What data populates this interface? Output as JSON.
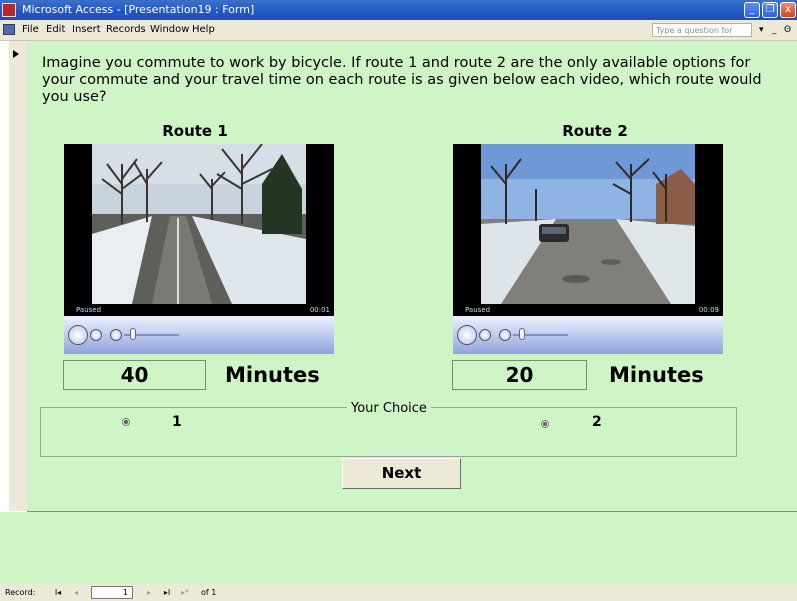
{
  "window": {
    "title": "Microsoft Access - [Presentation19 : Form]",
    "buttons": {
      "minimize": "_",
      "restore": "❐",
      "close": "x"
    }
  },
  "menu": {
    "items": [
      "File",
      "Edit",
      "Insert",
      "Records",
      "Window",
      "Help"
    ],
    "help_placeholder": "Type a question for help",
    "controls": [
      "▾",
      "_",
      "ʘ"
    ]
  },
  "form": {
    "question": "Imagine you commute to work by bicycle. If route 1 and route 2 are the only available options for your commute and your travel time on each route is as given below each video, which route would you use?",
    "routes": [
      {
        "title": "Route 1",
        "status": "Paused",
        "time": "00:01",
        "minutes": "40",
        "unit": "Minutes"
      },
      {
        "title": "Route 2",
        "status": "Paused",
        "time": "00:09",
        "minutes": "20",
        "unit": "Minutes"
      }
    ],
    "choice": {
      "label": "Your Choice",
      "options": [
        "1",
        "2"
      ]
    },
    "next_label": "Next"
  },
  "record_nav": {
    "label": "Record:",
    "first": "I◂",
    "prev": "◂",
    "current": "1",
    "next": "▸",
    "last": "▸I",
    "new": "▸*",
    "of_text": "of 1"
  }
}
